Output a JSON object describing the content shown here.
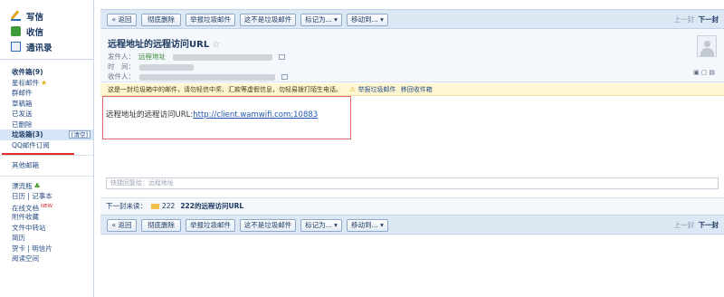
{
  "sidebar": {
    "top": [
      {
        "label": "写信",
        "icon": "compose-icon"
      },
      {
        "label": "收信",
        "icon": "inbox-icon"
      },
      {
        "label": "通讯录",
        "icon": "contacts-icon"
      }
    ],
    "folders": {
      "inbox": "收件箱(9)",
      "starred": "星标邮件",
      "group": "群邮件",
      "drafts": "草稿箱",
      "sent": "已发送",
      "deleted": "已删除",
      "spam": "垃圾箱(3)",
      "spam_clear": "[清空]",
      "subscriptions": "QQ邮件订阅"
    },
    "other_mailbox": "其他邮箱",
    "apps": {
      "bottle": "漂流瓶",
      "calendar": "日历",
      "memo": "记事本",
      "online_docs": "在线文档",
      "new_badge": "NEW",
      "attachments": "附件收藏",
      "file_transfer": "文件中转站",
      "resume": "简历",
      "cards": "贺卡",
      "postcards": "明信片",
      "reading": "阅读空间"
    }
  },
  "toolbar": {
    "back": "« 返回",
    "delete_forever": "彻底删除",
    "report_spam": "举报垃圾邮件",
    "not_spam": "这不是垃圾邮件",
    "mark_as": "标记为... ▾",
    "move_to": "移动到... ▾",
    "prev": "上一封",
    "next": "下一封"
  },
  "email": {
    "subject": "远程地址的远程访问URL",
    "from_label": "发件人：",
    "from_name": "远程地址",
    "time_label": "时　间：",
    "to_label": "收件人：",
    "notice": "这是一封垃圾箱中的邮件，请勿轻信中奖、汇款等虚假信息，勿轻易拨打陌生电话。",
    "notice_report": "举报垃圾邮件",
    "notice_move": "移回收件箱",
    "body_prefix": "远程地址的远程访问URL:",
    "body_link": "http://client.wamwifi.com:10883"
  },
  "quick_reply": {
    "placeholder": "快捷回复给：远程地址"
  },
  "next_mail": {
    "label": "下一封未读：",
    "sender": "222",
    "subject": "222的远程访问URL"
  }
}
